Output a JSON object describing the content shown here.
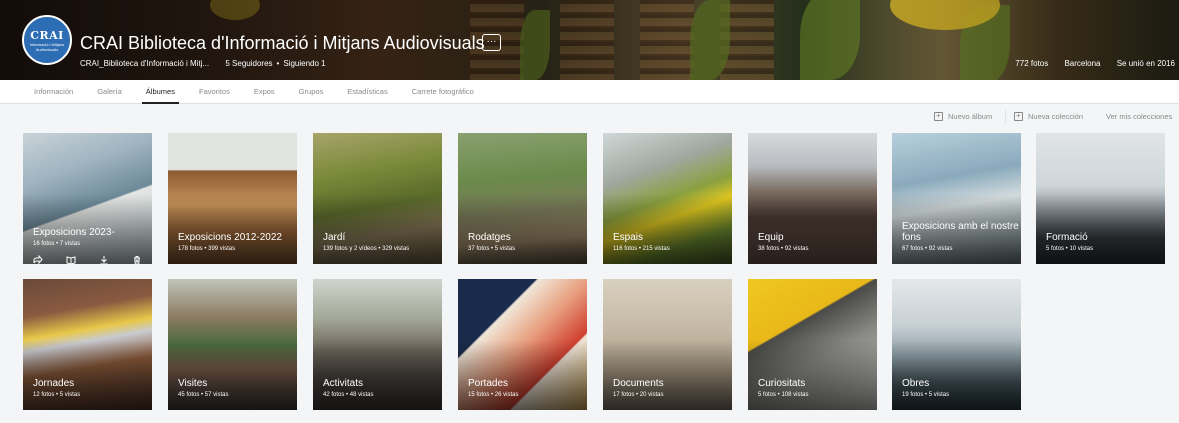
{
  "profile": {
    "avatar_text": "CRAI",
    "avatar_sub": "Informació i Mitjans Audiovisuals",
    "name": "CRAI Biblioteca d'Informació i Mitjans Audiovisuals",
    "more_label": "···",
    "username": "CRAI_Biblioteca d'Informació i Mitj...",
    "followers": "5 Seguidores",
    "following": "Siguiendo 1",
    "photos": "772 fotos",
    "location": "Barcelona",
    "joined": "Se unió en 2016"
  },
  "tabs": [
    {
      "label": "Información"
    },
    {
      "label": "Galería"
    },
    {
      "label": "Álbumes"
    },
    {
      "label": "Favoritos"
    },
    {
      "label": "Expos"
    },
    {
      "label": "Grupos"
    },
    {
      "label": "Estadísticas"
    },
    {
      "label": "Carrete fotográfico"
    }
  ],
  "active_tab": "Álbumes",
  "toolbar": {
    "new_album": "Nuevo álbum",
    "new_collection": "Nueva colección",
    "view_collections": "Ver mis colecciones"
  },
  "albums": [
    {
      "title": "Exposicions 2023-",
      "counts": "16 fotos  •  7 vistas"
    },
    {
      "title": "Exposicions 2012-2022",
      "counts": "178 fotos  •  399 vistas"
    },
    {
      "title": "Jardí",
      "counts": "139 fotos y 2 vídeos  •  329 vistas"
    },
    {
      "title": "Rodatges",
      "counts": "37 fotos  •  5 vistas"
    },
    {
      "title": "Espais",
      "counts": "116 fotos  •  215 vistas"
    },
    {
      "title": "Equip",
      "counts": "38 fotos  •  92 vistas"
    },
    {
      "title": "Exposicions amb el nostre fons",
      "counts": "67 fotos  •  92 vistas"
    },
    {
      "title": "Formació",
      "counts": "5 fotos  •  10 vistas"
    },
    {
      "title": "Jornades",
      "counts": "12 fotos  •  5 vistas"
    },
    {
      "title": "Visites",
      "counts": "45 fotos  •  57 vistas"
    },
    {
      "title": "Activitats",
      "counts": "42 fotos  •  48 vistas"
    },
    {
      "title": "Portades",
      "counts": "15 fotos  •  26 vistas"
    },
    {
      "title": "Documents",
      "counts": "17 fotos  •  20 vistas"
    },
    {
      "title": "Curiositats",
      "counts": "5 fotos  •  108 vistas"
    },
    {
      "title": "Obres",
      "counts": "19 fotos  •  5 vistas"
    }
  ],
  "album_actions": [
    "share-icon",
    "book-icon",
    "download-icon",
    "trash-icon"
  ],
  "colors": {
    "accent": "#212124",
    "muted": "#898989",
    "avatar_bg": "#2d6db4"
  }
}
